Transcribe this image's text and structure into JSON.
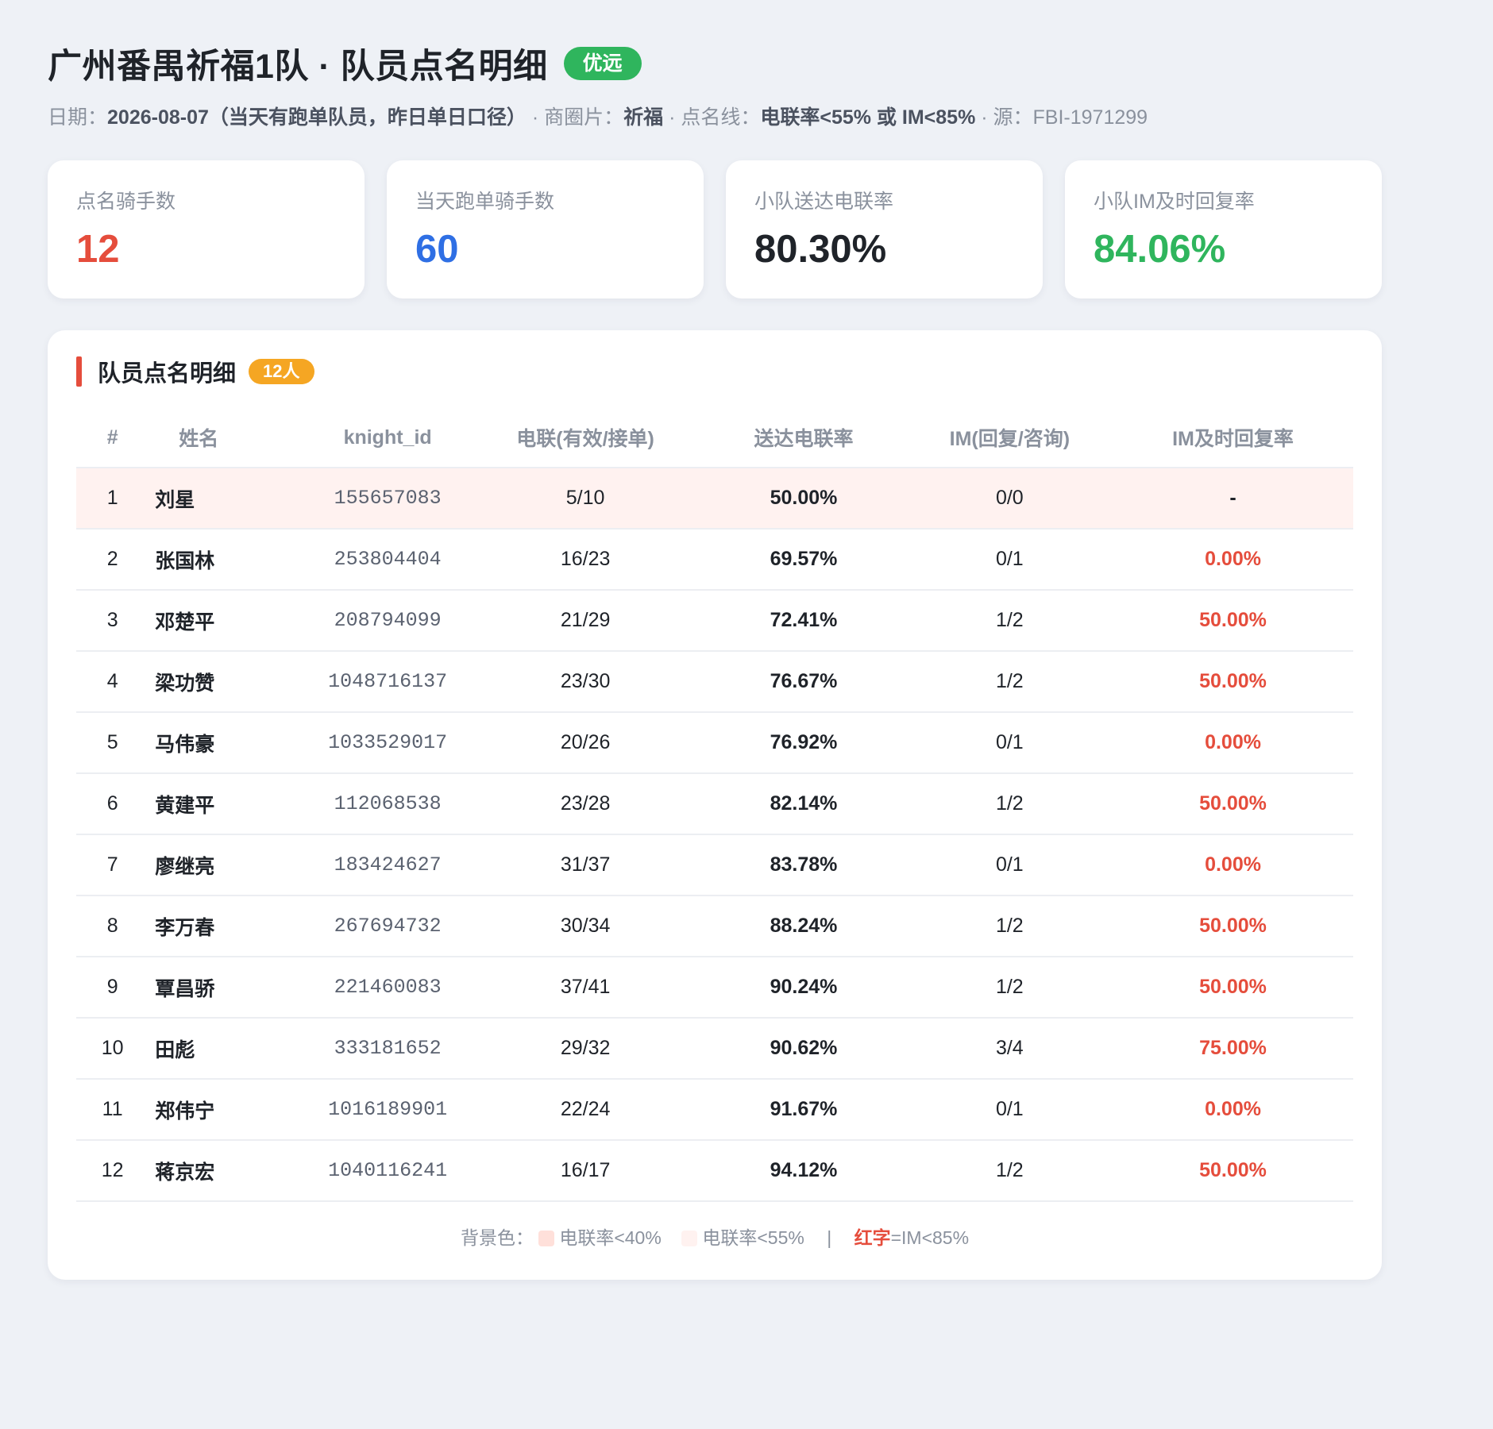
{
  "header": {
    "title": "广州番禺祈福1队 · 队员点名明细",
    "badge": "优远",
    "subtitle": {
      "date_label": "日期：",
      "date_value": "2026-08-07（当天有跑单队员，昨日单日口径）",
      "sep1": " · 商圈片：",
      "area_value": "祈福",
      "sep2": " · 点名线：",
      "line_value": "电联率<55% 或 IM<85%",
      "sep3": " · 源：",
      "source_value": "FBI-1971299"
    }
  },
  "kpis": [
    {
      "label": "点名骑手数",
      "value": "12",
      "color": "#e54d3c"
    },
    {
      "label": "当天跑单骑手数",
      "value": "60",
      "color": "#2f6fe4"
    },
    {
      "label": "小队送达电联率",
      "value": "80.30%",
      "color": "#1f2329"
    },
    {
      "label": "小队IM及时回复率",
      "value": "84.06%",
      "color": "#2fb55d"
    }
  ],
  "panel": {
    "title": "队员点名明细",
    "badge": "12人"
  },
  "table": {
    "headers": [
      "#",
      "姓名",
      "knight_id",
      "电联(有效/接单)",
      "送达电联率",
      "IM(回复/咨询)",
      "IM及时回复率"
    ],
    "rows": [
      {
        "idx": "1",
        "name": "刘星",
        "id": "155657083",
        "call": "5/10",
        "rate": "50.00%",
        "im": "0/0",
        "im_rate": "-",
        "im_red": false,
        "hl": "55"
      },
      {
        "idx": "2",
        "name": "张国林",
        "id": "253804404",
        "call": "16/23",
        "rate": "69.57%",
        "im": "0/1",
        "im_rate": "0.00%",
        "im_red": true,
        "hl": ""
      },
      {
        "idx": "3",
        "name": "邓楚平",
        "id": "208794099",
        "call": "21/29",
        "rate": "72.41%",
        "im": "1/2",
        "im_rate": "50.00%",
        "im_red": true,
        "hl": ""
      },
      {
        "idx": "4",
        "name": "梁功赞",
        "id": "1048716137",
        "call": "23/30",
        "rate": "76.67%",
        "im": "1/2",
        "im_rate": "50.00%",
        "im_red": true,
        "hl": ""
      },
      {
        "idx": "5",
        "name": "马伟豪",
        "id": "1033529017",
        "call": "20/26",
        "rate": "76.92%",
        "im": "0/1",
        "im_rate": "0.00%",
        "im_red": true,
        "hl": ""
      },
      {
        "idx": "6",
        "name": "黄建平",
        "id": "112068538",
        "call": "23/28",
        "rate": "82.14%",
        "im": "1/2",
        "im_rate": "50.00%",
        "im_red": true,
        "hl": ""
      },
      {
        "idx": "7",
        "name": "廖继亮",
        "id": "183424627",
        "call": "31/37",
        "rate": "83.78%",
        "im": "0/1",
        "im_rate": "0.00%",
        "im_red": true,
        "hl": ""
      },
      {
        "idx": "8",
        "name": "李万春",
        "id": "267694732",
        "call": "30/34",
        "rate": "88.24%",
        "im": "1/2",
        "im_rate": "50.00%",
        "im_red": true,
        "hl": ""
      },
      {
        "idx": "9",
        "name": "覃昌骄",
        "id": "221460083",
        "call": "37/41",
        "rate": "90.24%",
        "im": "1/2",
        "im_rate": "50.00%",
        "im_red": true,
        "hl": ""
      },
      {
        "idx": "10",
        "name": "田彪",
        "id": "333181652",
        "call": "29/32",
        "rate": "90.62%",
        "im": "3/4",
        "im_rate": "75.00%",
        "im_red": true,
        "hl": ""
      },
      {
        "idx": "11",
        "name": "郑伟宁",
        "id": "1016189901",
        "call": "22/24",
        "rate": "91.67%",
        "im": "0/1",
        "im_rate": "0.00%",
        "im_red": true,
        "hl": ""
      },
      {
        "idx": "12",
        "name": "蒋京宏",
        "id": "1040116241",
        "call": "16/17",
        "rate": "94.12%",
        "im": "1/2",
        "im_rate": "50.00%",
        "im_red": true,
        "hl": ""
      }
    ]
  },
  "legend": {
    "prefix": "背景色：",
    "item1": "电联率<40%",
    "item1_color": "#ffe0da",
    "item2": "电联率<55%",
    "item2_color": "#fff2f0",
    "sep": "|",
    "red_word": "红字",
    "red_rest": "=IM<85%"
  },
  "colors": {
    "accent_red": "#e54d3c",
    "accent_blue": "#2f6fe4",
    "accent_green": "#2fb55d",
    "accent_orange": "#f5a623"
  }
}
